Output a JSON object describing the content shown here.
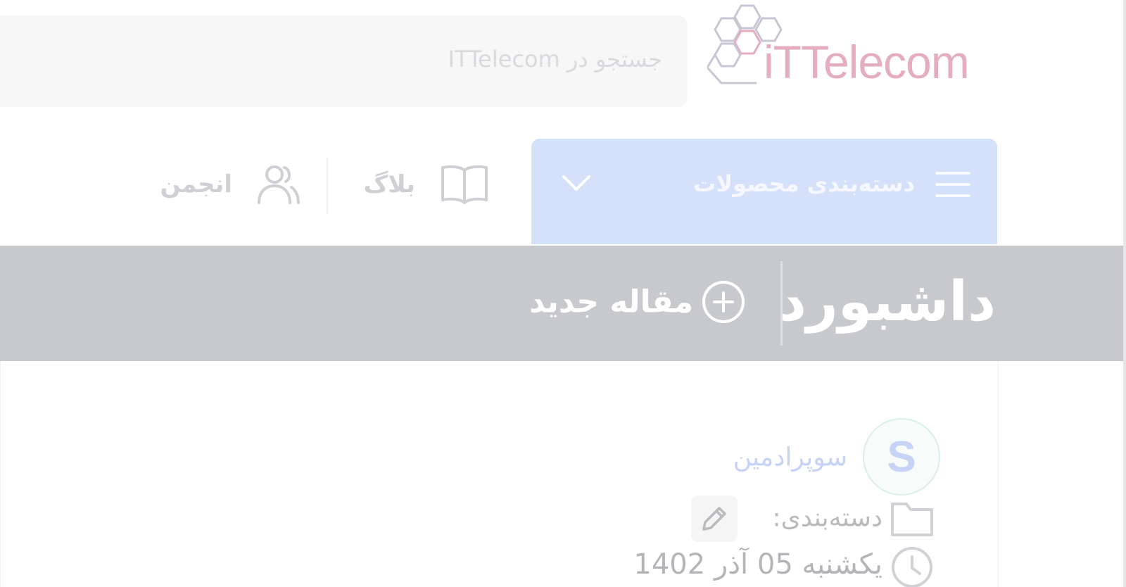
{
  "header": {
    "logo_text": "iTTelecom",
    "search_placeholder": "جستجو در ITTelecom"
  },
  "nav": {
    "categories_label": "دسته‌بندی محصولات",
    "blog_label": "بلاگ",
    "forum_label": "انجمن"
  },
  "dashboard": {
    "title": "داشبورد",
    "new_article_label": "مقاله جدید"
  },
  "post": {
    "author_initial": "S",
    "author_name": "سوپرادمین",
    "category_label": "دسته‌بندی:",
    "date": "یکشنبه 05 آذر 1402"
  },
  "colors": {
    "accent_light": "#d5e0fa",
    "dashboard_bar": "#c8c9cd",
    "author_text": "#c7d2f7"
  }
}
